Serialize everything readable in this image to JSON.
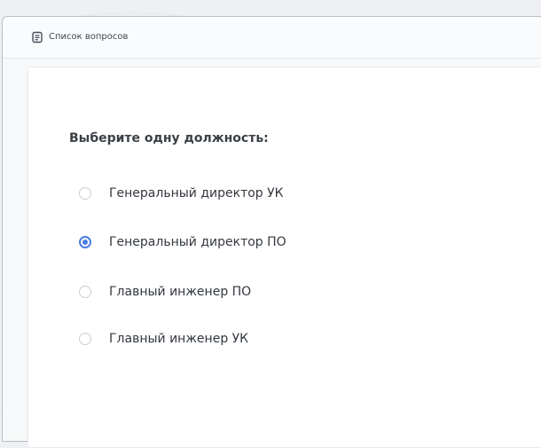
{
  "header": {
    "title": "Список вопросов",
    "icon": "document-list-icon"
  },
  "question": {
    "title": "Выберите одну должность:",
    "options": [
      {
        "label": "Генеральный директор УК",
        "selected": false
      },
      {
        "label": "Генеральный директор ПО",
        "selected": true
      },
      {
        "label": "Главный инженер ПО",
        "selected": false
      },
      {
        "label": "Главный инженер УК",
        "selected": false
      }
    ]
  },
  "colors": {
    "accent": "#4b7be5",
    "text": "#33383f",
    "border": "#c9cdd2"
  }
}
